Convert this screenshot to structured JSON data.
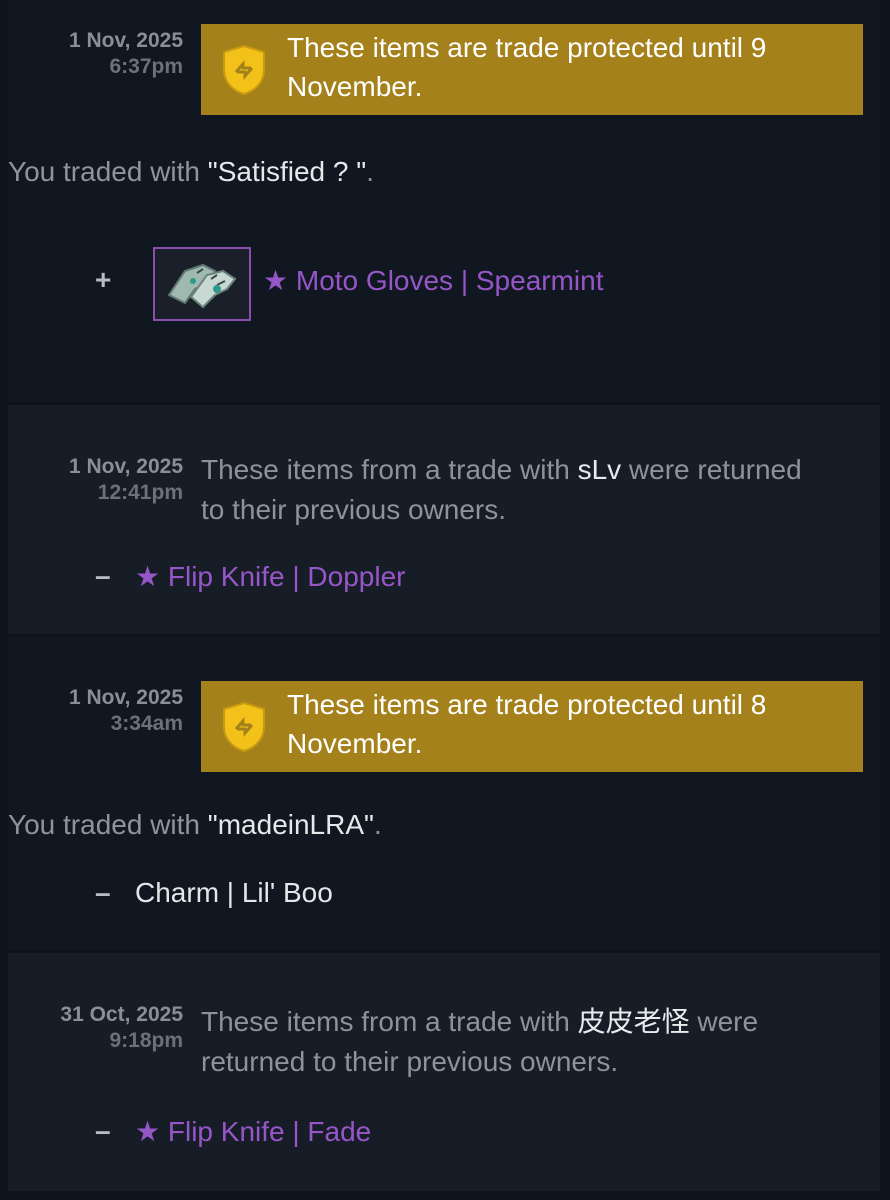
{
  "entries": [
    {
      "date": "1 Nov, 2025",
      "time": "6:37pm",
      "banner": "These items are trade protected until 9 November.",
      "traded_prefix": "You traded with ",
      "traded_name": "\"Satisfied ? \"",
      "traded_suffix": ".",
      "item_symbol": "+",
      "item_name": "★ Moto Gloves | Spearmint",
      "item_color": "#9656c8",
      "item_icon": "gloves-icon"
    },
    {
      "date": "1 Nov, 2025",
      "time": "12:41pm",
      "msg_prefix": "These items from a trade with ",
      "msg_user": "sLv",
      "msg_suffix": " were returned to their previous owners.",
      "item_symbol": "–",
      "item_name": "★ Flip Knife | Doppler",
      "item_color": "#9656c8"
    },
    {
      "date": "1 Nov, 2025",
      "time": "3:34am",
      "banner": "These items are trade protected until 8 November.",
      "traded_prefix": "You traded with ",
      "traded_name": "\"madeinLRA\"",
      "traded_suffix": ".",
      "item_symbol": "–",
      "item_name": "Charm | Lil' Boo",
      "item_color": "#e4e6e8"
    },
    {
      "date": "31 Oct, 2025",
      "time": "9:18pm",
      "msg_prefix": "These items from a trade with ",
      "msg_user": "皮皮老怪",
      "msg_suffix": " were returned to their previous owners.",
      "item_symbol": "–",
      "item_name": "★ Flip Knife | Fade",
      "item_color": "#9656c8"
    }
  ],
  "colors": {
    "banner_bg": "#a5811b",
    "rare_item": "#9656c8",
    "page_bg": "#0e141b"
  }
}
